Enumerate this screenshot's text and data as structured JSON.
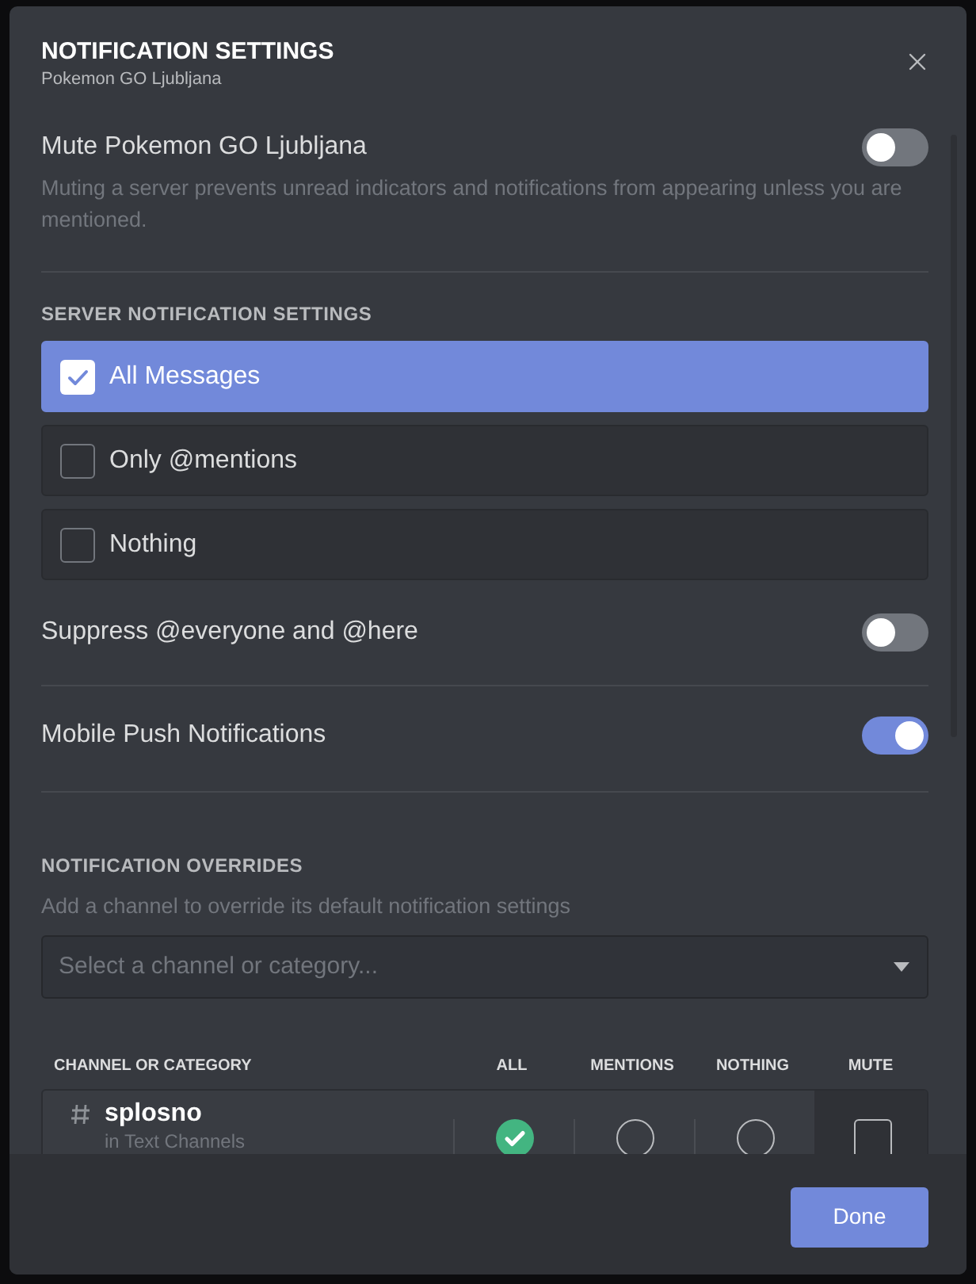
{
  "dialog": {
    "title": "NOTIFICATION SETTINGS",
    "subtitle": "Pokemon GO Ljubljana"
  },
  "mute": {
    "label": "Mute Pokemon GO Ljubljana",
    "on": false,
    "description": "Muting a server prevents unread indicators and notifications from appearing unless you are mentioned."
  },
  "server_notification_settings": {
    "heading": "SERVER NOTIFICATION SETTINGS",
    "options": [
      {
        "label": "All Messages",
        "selected": true
      },
      {
        "label": "Only @mentions",
        "selected": false
      },
      {
        "label": "Nothing",
        "selected": false
      }
    ]
  },
  "toggles": [
    {
      "label": "Suppress @everyone and @here",
      "on": false
    },
    {
      "label": "Mobile Push Notifications",
      "on": true
    }
  ],
  "overrides": {
    "heading": "NOTIFICATION OVERRIDES",
    "description": "Add a channel to override its default notification settings",
    "select": {
      "placeholder": "Select a channel or category..."
    },
    "table": {
      "columns": [
        "CHANNEL OR CATEGORY",
        "ALL",
        "MENTIONS",
        "NOTHING",
        "MUTE"
      ],
      "rows": [
        {
          "name": "splosno",
          "category": "in Text Channels",
          "radios": [
            {
              "selected": true
            },
            {
              "selected": false
            },
            {
              "selected": false
            }
          ],
          "muted": false
        }
      ]
    }
  },
  "footer": {
    "done": "Done"
  }
}
